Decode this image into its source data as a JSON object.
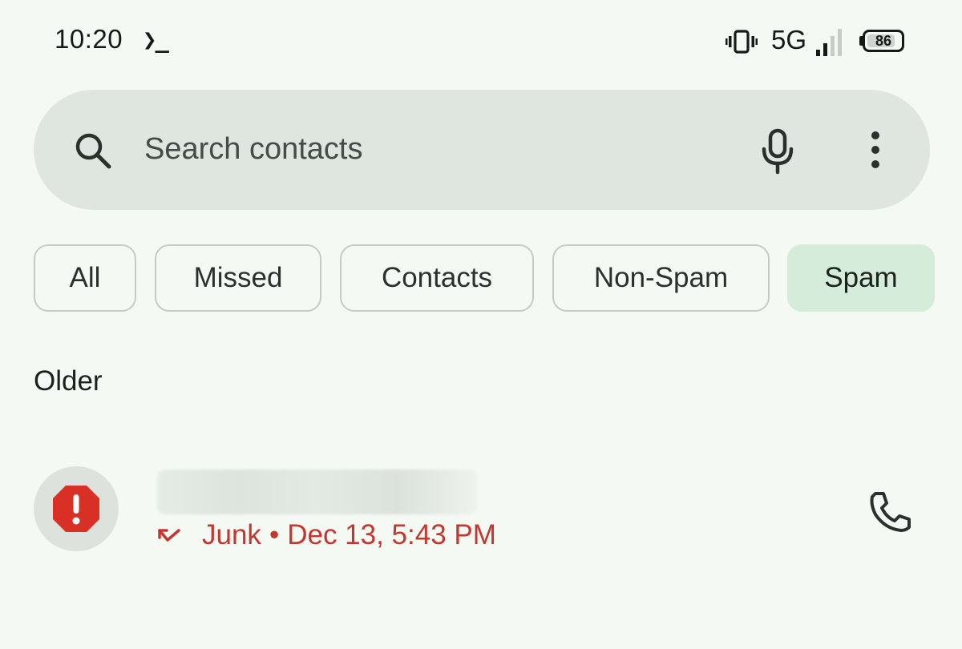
{
  "status_bar": {
    "time": "10:20",
    "terminal_glyph": "❯_",
    "network": "5G",
    "battery": 86,
    "battery_label": "86"
  },
  "search": {
    "placeholder": "Search contacts",
    "value": ""
  },
  "filters": [
    {
      "label": "All",
      "selected": false
    },
    {
      "label": "Missed",
      "selected": false
    },
    {
      "label": "Contacts",
      "selected": false
    },
    {
      "label": "Non-Spam",
      "selected": false
    },
    {
      "label": "Spam",
      "selected": true
    }
  ],
  "section": {
    "title": "Older"
  },
  "calls": [
    {
      "name": "",
      "type": "Junk",
      "separator": "•",
      "date": "Dec 13, 5:43 PM",
      "status_color": "#c4372f",
      "avatar_icon": "spam-warning-icon"
    }
  ],
  "colors": {
    "background": "#f4faf3",
    "search_bg": "#dfe6e0",
    "chip_selected": "#d6ecda",
    "spam_red": "#d93025"
  }
}
